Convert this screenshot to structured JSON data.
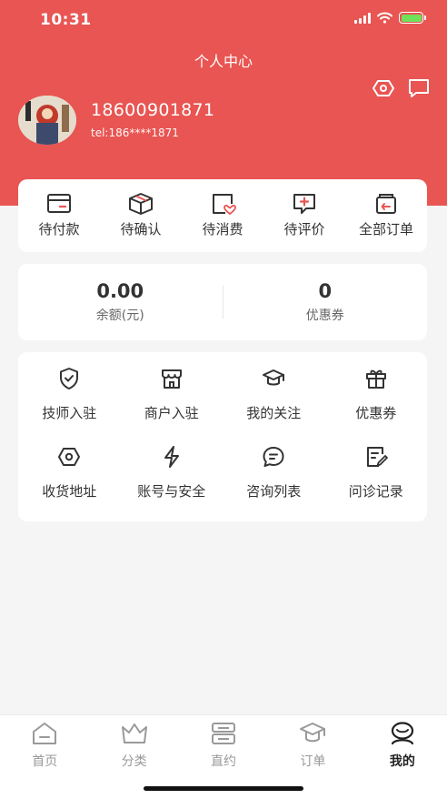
{
  "status_bar": {
    "time": "10:31"
  },
  "header": {
    "title": "个人中心",
    "settings_icon": "hexagon-settings-icon",
    "message_icon": "message-icon"
  },
  "profile": {
    "name": "18600901871",
    "tel": "tel:186****1871"
  },
  "orders": [
    {
      "label": "待付款",
      "icon": "wallet-card-icon"
    },
    {
      "label": "待确认",
      "icon": "box-icon"
    },
    {
      "label": "待消费",
      "icon": "heart-ticket-icon"
    },
    {
      "label": "待评价",
      "icon": "comment-plus-icon"
    },
    {
      "label": "全部订单",
      "icon": "order-return-icon"
    }
  ],
  "balance": {
    "amount": "0.00",
    "amount_label": "余额(元)",
    "coupons": "0",
    "coupons_label": "优惠券"
  },
  "services": [
    {
      "label": "技师入驻",
      "icon": "shield-check-icon"
    },
    {
      "label": "商户入驻",
      "icon": "store-icon"
    },
    {
      "label": "我的关注",
      "icon": "graduation-cap-icon"
    },
    {
      "label": "优惠券",
      "icon": "gift-icon"
    },
    {
      "label": "收货地址",
      "icon": "hexagon-location-icon"
    },
    {
      "label": "账号与安全",
      "icon": "lightning-icon"
    },
    {
      "label": "咨询列表",
      "icon": "chat-bubble-icon"
    },
    {
      "label": "问诊记录",
      "icon": "edit-record-icon"
    }
  ],
  "tabbar": [
    {
      "label": "首页",
      "icon": "home-icon",
      "active": false
    },
    {
      "label": "分类",
      "icon": "crown-icon",
      "active": false
    },
    {
      "label": "直约",
      "icon": "appointment-icon",
      "active": false
    },
    {
      "label": "订单",
      "icon": "cap-order-icon",
      "active": false
    },
    {
      "label": "我的",
      "icon": "profile-icon",
      "active": true
    }
  ],
  "colors": {
    "brand": "#e85552",
    "background": "#f5f5f5",
    "icon_stroke": "#333333",
    "tab_inactive": "#999999"
  }
}
